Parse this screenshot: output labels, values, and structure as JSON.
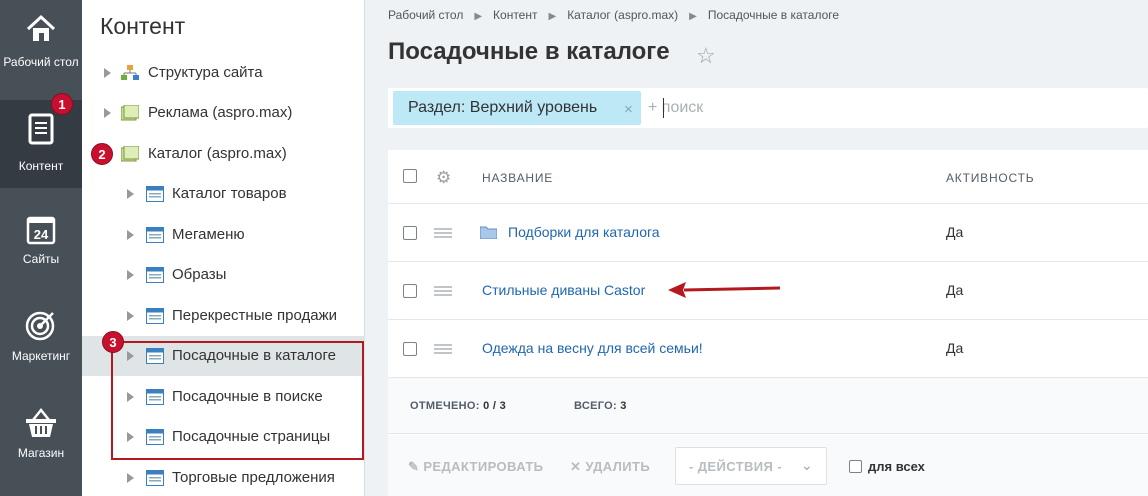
{
  "rail": {
    "items": [
      {
        "label": "Рабочий стол",
        "icon": "desktop-house-icon"
      },
      {
        "label": "Контент",
        "icon": "document-icon"
      },
      {
        "label": "Сайты",
        "icon": "calendar-24-icon"
      },
      {
        "label": "Маркетинг",
        "icon": "target-icon"
      },
      {
        "label": "Магазин",
        "icon": "basket-icon"
      }
    ]
  },
  "tree": {
    "title": "Контент",
    "items": [
      {
        "label": "Структура сайта",
        "icon": "site-structure-icon"
      },
      {
        "label": "Реклама (aspro.max)",
        "icon": "infoblock-type-icon"
      },
      {
        "label": "Каталог (aspro.max)",
        "icon": "infoblock-type-icon"
      },
      {
        "label": "Каталог товаров",
        "icon": "infoblock-icon"
      },
      {
        "label": "Мегаменю",
        "icon": "infoblock-icon"
      },
      {
        "label": "Образы",
        "icon": "infoblock-icon"
      },
      {
        "label": "Перекрестные продажи",
        "icon": "infoblock-icon"
      },
      {
        "label": "Посадочные в каталоге",
        "icon": "infoblock-icon"
      },
      {
        "label": "Посадочные в поиске",
        "icon": "infoblock-icon"
      },
      {
        "label": "Посадочные страницы",
        "icon": "infoblock-icon"
      },
      {
        "label": "Торговые предложения",
        "icon": "infoblock-icon"
      }
    ]
  },
  "breadcrumbs": [
    "Рабочий стол",
    "Контент",
    "Каталог (aspro.max)",
    "Посадочные в каталоге"
  ],
  "page_title": "Посадочные в каталоге",
  "filter": {
    "chip_label": "Раздел: Верхний уровень",
    "chip_close": "×",
    "placeholder": "+ поиск"
  },
  "grid": {
    "columns": {
      "name": "НАЗВАНИЕ",
      "active": "АКТИВНОСТЬ"
    },
    "rows": [
      {
        "name": "Подборки для каталога",
        "active": "Да",
        "type": "folder"
      },
      {
        "name": "Стильные диваны Castor",
        "active": "Да",
        "type": "element"
      },
      {
        "name": "Одежда на весну для всей семьи!",
        "active": "Да",
        "type": "element"
      }
    ],
    "stats": {
      "selected_label": "ОТМЕЧЕНО:",
      "selected_value": "0 / 3",
      "total_label": "ВСЕГО:",
      "total_value": "3"
    },
    "actions": {
      "edit": "РЕДАКТИРОВАТЬ",
      "delete": "УДАЛИТЬ",
      "select": "- ДЕЙСТВИЯ -",
      "for_all": "для всех"
    }
  },
  "annotations": {
    "badges": [
      "1",
      "2",
      "3"
    ],
    "colors": {
      "annotation": "#c8102e",
      "link": "#2067b0",
      "chip": "#bde8f6"
    }
  }
}
